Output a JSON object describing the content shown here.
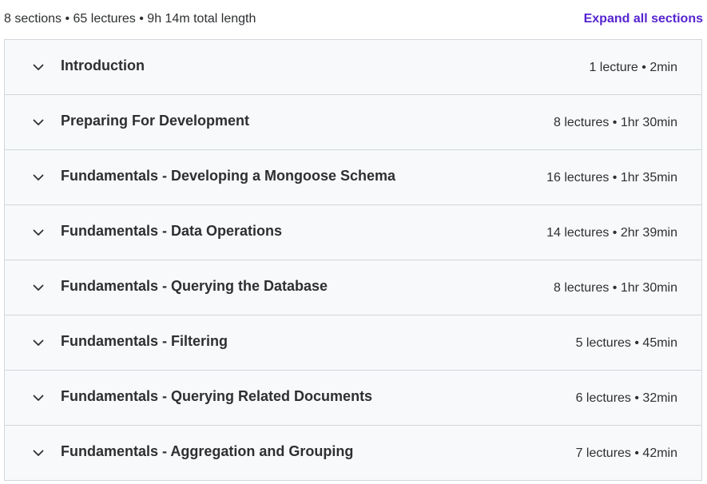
{
  "summary": {
    "text": "8 sections • 65 lectures • 9h 14m total length",
    "expand_label": "Expand all sections"
  },
  "sections": [
    {
      "title": "Introduction",
      "meta": "1 lecture • 2min",
      "icon": "chevron-down-icon"
    },
    {
      "title": "Preparing For Development",
      "meta": "8 lectures • 1hr 30min",
      "icon": "chevron-down-icon"
    },
    {
      "title": "Fundamentals - Developing a Mongoose Schema",
      "meta": "16 lectures • 1hr 35min",
      "icon": "chevron-down-icon"
    },
    {
      "title": "Fundamentals - Data Operations",
      "meta": "14 lectures • 2hr 39min",
      "icon": "chevron-down-icon"
    },
    {
      "title": "Fundamentals - Querying the Database",
      "meta": "8 lectures • 1hr 30min",
      "icon": "chevron-down-icon"
    },
    {
      "title": "Fundamentals - Filtering",
      "meta": "5 lectures • 45min",
      "icon": "chevron-down-icon"
    },
    {
      "title": "Fundamentals - Querying Related Documents",
      "meta": "6 lectures • 32min",
      "icon": "chevron-down-icon"
    },
    {
      "title": "Fundamentals - Aggregation and Grouping",
      "meta": "7 lectures • 42min",
      "icon": "chevron-down-icon"
    }
  ],
  "colors": {
    "accent": "#5624d0",
    "text": "#2d2f31",
    "row_background": "#f7f9fa",
    "border": "#d1d7dc"
  }
}
